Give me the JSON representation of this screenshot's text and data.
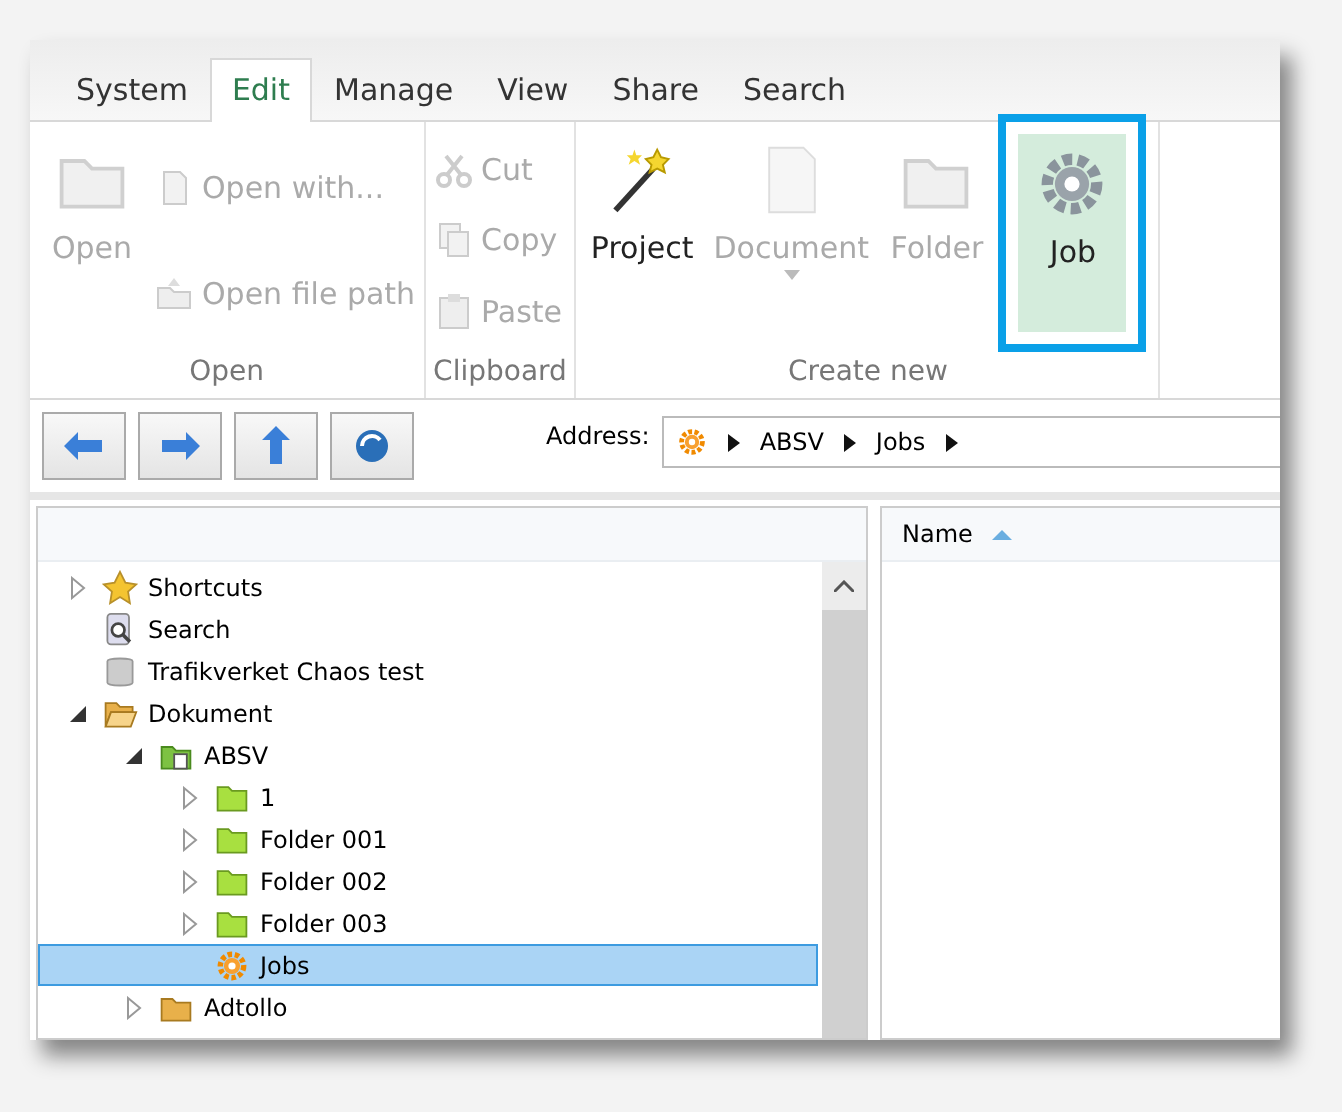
{
  "tabs": [
    {
      "label": "System",
      "selected": false
    },
    {
      "label": "Edit",
      "selected": true
    },
    {
      "label": "Manage",
      "selected": false
    },
    {
      "label": "View",
      "selected": false
    },
    {
      "label": "Share",
      "selected": false
    },
    {
      "label": "Search",
      "selected": false
    }
  ],
  "ribbon": {
    "groups": [
      {
        "title": "Open",
        "items": [
          {
            "kind": "large",
            "label": "Open",
            "disabled": true
          },
          {
            "kind": "small",
            "label": "Open with...",
            "disabled": true
          },
          {
            "kind": "small",
            "label": "Open file path",
            "disabled": true
          }
        ]
      },
      {
        "title": "Clipboard",
        "items": [
          {
            "kind": "small",
            "label": "Cut",
            "disabled": true
          },
          {
            "kind": "small",
            "label": "Copy",
            "disabled": true
          },
          {
            "kind": "small",
            "label": "Paste",
            "disabled": true
          }
        ]
      },
      {
        "title": "Create new",
        "items": [
          {
            "kind": "large",
            "label": "Project",
            "disabled": false,
            "highlighted": false
          },
          {
            "kind": "large",
            "label": "Document",
            "disabled": true,
            "highlighted": false,
            "dropdown": true
          },
          {
            "kind": "large",
            "label": "Folder",
            "disabled": true,
            "highlighted": false
          },
          {
            "kind": "large",
            "label": "Job",
            "disabled": false,
            "highlighted": true
          }
        ]
      }
    ]
  },
  "address": {
    "label": "Address:",
    "crumbs": [
      "ABSV",
      "Jobs"
    ]
  },
  "tree": [
    {
      "label": "Shortcuts",
      "kind": "star",
      "expanded": false,
      "selected": false
    },
    {
      "label": "Search",
      "kind": "search",
      "selected": false
    },
    {
      "label": "Trafikverket Chaos test",
      "kind": "database",
      "selected": false
    },
    {
      "label": "Dokument",
      "kind": "folder-open",
      "expanded": true,
      "selected": false,
      "children": [
        {
          "label": "ABSV",
          "kind": "project",
          "expanded": true,
          "selected": false,
          "children": [
            {
              "label": "1",
              "kind": "green-folder",
              "expanded": false,
              "selected": false
            },
            {
              "label": "Folder 001",
              "kind": "green-folder",
              "expanded": false,
              "selected": false
            },
            {
              "label": "Folder 002",
              "kind": "green-folder",
              "expanded": false,
              "selected": false
            },
            {
              "label": "Folder 003",
              "kind": "green-folder",
              "expanded": false,
              "selected": false
            },
            {
              "label": "Jobs",
              "kind": "gear",
              "selected": true
            }
          ]
        },
        {
          "label": "Adtollo",
          "kind": "folder",
          "expanded": false,
          "selected": false
        }
      ]
    }
  ],
  "list": {
    "columns": [
      {
        "label": "Name",
        "sorted_ascending": true
      }
    ]
  }
}
